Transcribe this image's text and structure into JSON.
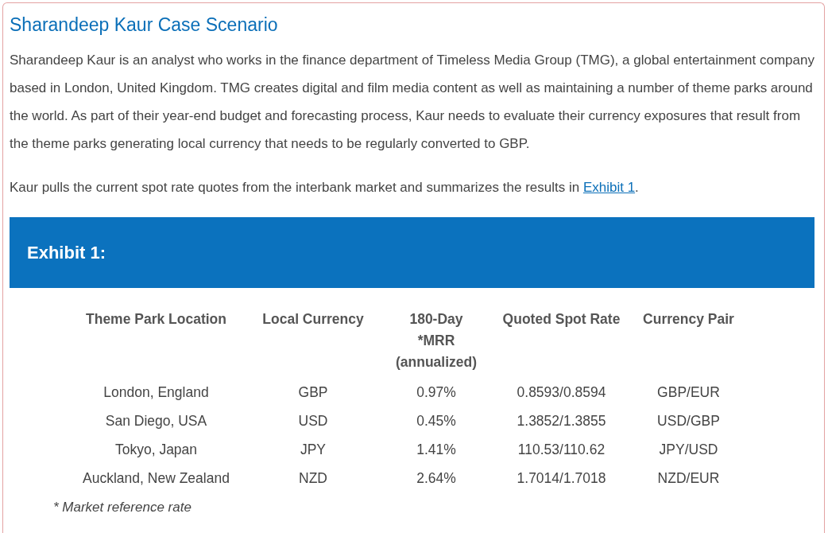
{
  "title": "Sharandeep Kaur Case Scenario",
  "paragraph": "Sharandeep Kaur is an analyst who works in the finance department of Timeless Media Group (TMG), a global entertainment company based in London, United Kingdom. TMG creates digital and film media content as well as maintaining a number of theme parks around the world. As part of their year-end budget and forecasting process, Kaur needs to evaluate their currency exposures that result from the theme parks generating local currency that needs to be regularly converted to GBP.",
  "summary": {
    "text": "Kaur pulls the current spot rate quotes from the interbank market and summarizes the results in ",
    "link": "Exhibit 1",
    "after": "."
  },
  "exhibit": {
    "title": "Exhibit 1:",
    "table": {
      "columns": [
        "Theme Park Location",
        "Local Currency",
        "180-Day *MRR (annualized)",
        "Quoted Spot Rate",
        "Currency Pair"
      ],
      "rows": [
        [
          "London, England",
          "GBP",
          "0.97%",
          "0.8593/0.8594",
          "GBP/EUR"
        ],
        [
          "San Diego, USA",
          "USD",
          "0.45%",
          "1.3852/1.3855",
          "USD/GBP"
        ],
        [
          "Tokyo, Japan",
          "JPY",
          "1.41%",
          "110.53/110.62",
          "JPY/USD"
        ],
        [
          "Auckland, New Zealand",
          "NZD",
          "2.64%",
          "1.7014/1.7018",
          "NZD/EUR"
        ]
      ]
    },
    "footnote": "* Market reference rate"
  }
}
